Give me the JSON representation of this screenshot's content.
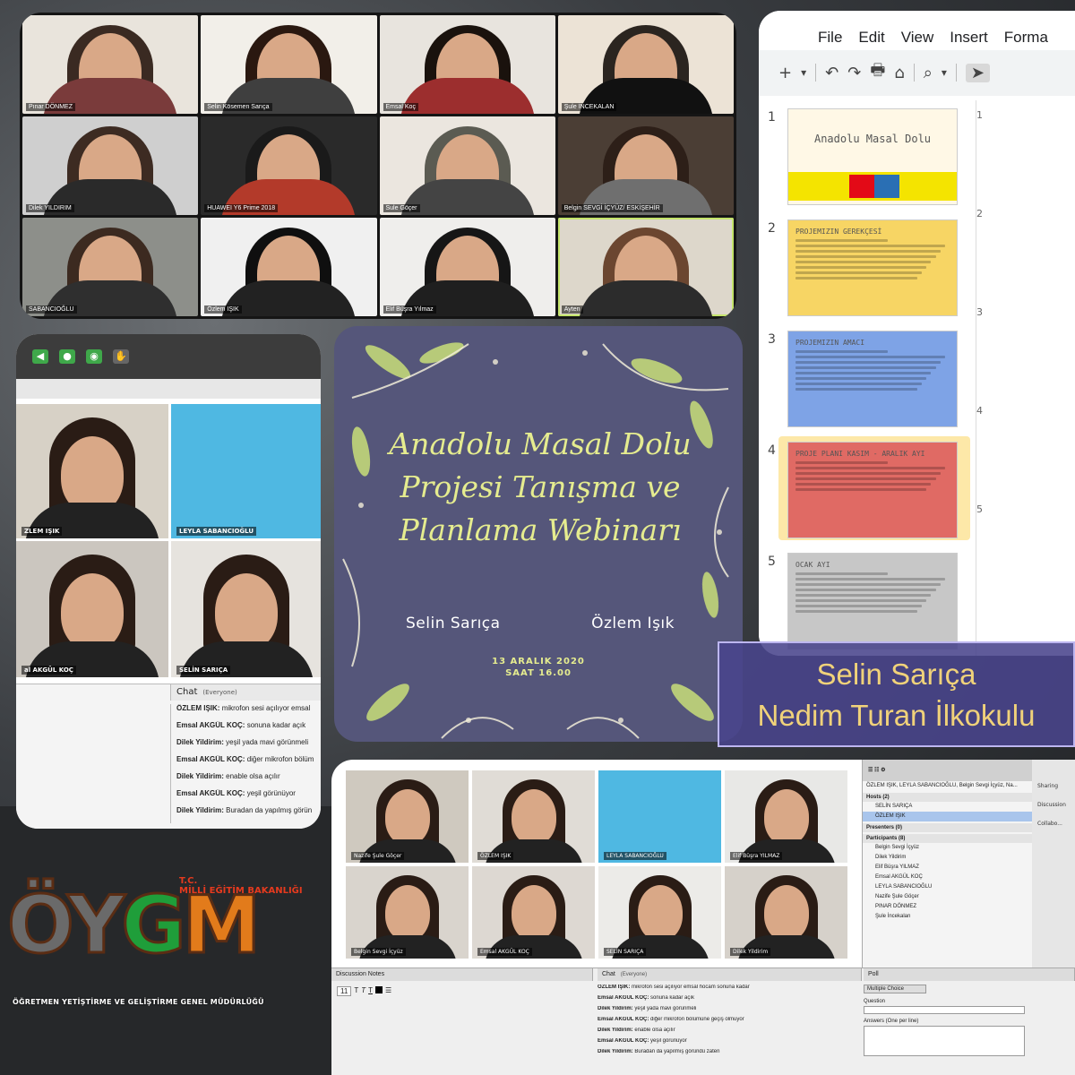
{
  "zoom": {
    "participants": [
      "Pınar DÖNMEZ",
      "Selin Kösemen Sarıça",
      "Emsal Koç",
      "Şule İNCEKALAN",
      "Dilek YILDIRIM",
      "HUAWEI Y6 Prime 2018",
      "Sule Göçer",
      "Belgin SEVGİ İÇYÜZ/ ESKİŞEHİR",
      "SABANCIOĞLU",
      "Özlem IŞIK",
      "Elif Büşra Yılmaz",
      "Ayten"
    ]
  },
  "slides": {
    "menu": [
      "File",
      "Edit",
      "View",
      "Insert",
      "Forma"
    ],
    "toolbar": [
      "+",
      "▾",
      "↶",
      "↷",
      "🖶",
      "⌂",
      "⌕",
      "▾",
      "➤"
    ],
    "items": [
      {
        "num": "1",
        "title": "Anadolu Masal Dolu",
        "color": "#fff8e6"
      },
      {
        "num": "2",
        "title": "PROJEMIZIN GEREKÇESİ",
        "color": "#f7d564"
      },
      {
        "num": "3",
        "title": "PROJEMIZIN AMACI",
        "color": "#7ea3e6"
      },
      {
        "num": "4",
        "title": "PROJE PLANI KASIM - ARALIK AYI",
        "color": "#e06a64"
      },
      {
        "num": "5",
        "title": "OCAK AYI",
        "color": "#c7c7c7"
      }
    ],
    "ruler": [
      "1",
      "2",
      "3",
      "4",
      "5"
    ]
  },
  "conf_left": {
    "videos": [
      "ZLEM IŞIK",
      "LEYLA SABANCIOĞLU",
      "al AKGÜL KOÇ",
      "SELİN SARIÇA"
    ],
    "chat_title": "Chat",
    "chat_scope": "(Everyone)",
    "chat": [
      {
        "who": "ÖZLEM IŞIK:",
        "msg": "mikrofon sesi açılıyor emsal"
      },
      {
        "who": "Emsal AKGÜL KOÇ:",
        "msg": "sonuna kadar açık"
      },
      {
        "who": "Dilek Yildirim:",
        "msg": "yeşil yada mavi görünmeli"
      },
      {
        "who": "Emsal AKGÜL KOÇ:",
        "msg": "diğer mikrofon bölüm"
      },
      {
        "who": "Dilek Yildirim:",
        "msg": "enable olsa açılır"
      },
      {
        "who": "Emsal AKGÜL KOÇ:",
        "msg": "yeşil görünüyor"
      },
      {
        "who": "Dilek Yildirim:",
        "msg": "Buradan da yapılmış görün"
      }
    ]
  },
  "poster": {
    "title_lines": [
      "Anadolu Masal Dolu",
      "Projesi Tanışma ve",
      "Planlama Webinarı"
    ],
    "name1": "Selin Sarıça",
    "name2": "Özlem Işık",
    "date": "13 ARALIK 2020",
    "time": "SAAT 16.00"
  },
  "badge": {
    "line1": "Selin Sarıça",
    "line2": "Nedim Turan İlkokulu"
  },
  "conf_bottom": {
    "videos": [
      "Nazife Şule Göçer",
      "ÖZLEM IŞIK",
      "LEYLA SABANCIOĞLU",
      "Elif Büşra YILMAZ",
      "Belgin Sevgi İçyüz",
      "Emsal AKGÜL KOÇ",
      "SELİN SARIÇA",
      "Dilek Yildirim"
    ],
    "attendee_line": "ÖZLEM IŞIK, LEYLA SABANCIOĞLU, Belgin Sevgi İçyüz, Na...",
    "hosts_label": "Hosts (2)",
    "hosts": [
      "SELİN SARIÇA",
      "ÖZLEM IŞIK"
    ],
    "presenters_label": "Presenters (0)",
    "participants_label": "Participants (8)",
    "participants": [
      "Belgin Sevgi İçyüz",
      "Dilek Yildirim",
      "Elif Büşra YILMAZ",
      "Emsal AKGÜL KOÇ",
      "LEYLA SABANCIOĞLU",
      "Nazife Şule Göçer",
      "PINAR DÖNMEZ",
      "Şule İncekalan"
    ],
    "sharing": [
      "Sharing",
      "Discussion",
      "Collabo..."
    ],
    "notes_title": "Discussion Notes",
    "font_size": "11",
    "chat_title": "Chat",
    "chat_scope": "(Everyone)",
    "chat": [
      {
        "who": "ÖZLEM IŞIK:",
        "msg": "mikrofon sesi açılıyor emsal hocam sonuna kadar"
      },
      {
        "who": "Emsal AKGÜL KOÇ:",
        "msg": "sonuna kadar açık"
      },
      {
        "who": "Dilek Yildirim:",
        "msg": "yeşil yada mavi görünmeli"
      },
      {
        "who": "Emsal AKGÜL KOÇ:",
        "msg": "diğer mikrofon bölümüne geçiş olmuyor"
      },
      {
        "who": "Dilek Yildirim:",
        "msg": "enable olsa açılır"
      },
      {
        "who": "Emsal AKGÜL KOÇ:",
        "msg": "yeşil görünüyor"
      },
      {
        "who": "Dilek Yildirim:",
        "msg": "Buradan da yapılmış göründü zaten"
      }
    ],
    "poll_title": "Poll",
    "poll_type": "Multiple Choice",
    "question_label": "Question",
    "answers_label": "Answers (One per line)"
  },
  "logo": {
    "letters": [
      "Ö",
      "Y",
      "G",
      "M"
    ],
    "ministry": "MİLLİ EĞİTİM BAKANLIĞI",
    "tc": "T.C.",
    "subtitle": "ÖĞRETMEN YETİŞTİRME VE GELİŞTİRME GENEL MÜDÜRLÜĞÜ"
  }
}
